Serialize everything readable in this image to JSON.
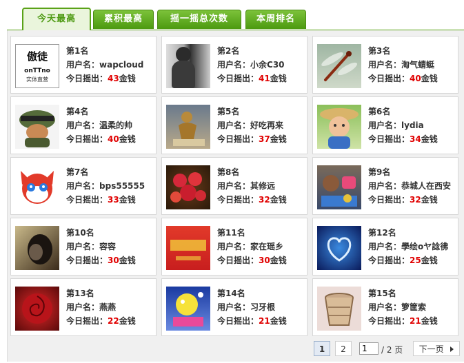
{
  "tabs": [
    {
      "label": "今天最高",
      "active": true
    },
    {
      "label": "累积最高",
      "active": false
    },
    {
      "label": "摇一摇总次数",
      "active": false
    },
    {
      "label": "本周排名",
      "active": false
    }
  ],
  "field_labels": {
    "user": "用户名：",
    "today": "今日摇出：",
    "unit": "金钱"
  },
  "logo_text": {
    "line1": "傲徒",
    "line2": "onTTno",
    "line3": "实体直营"
  },
  "rankings": [
    {
      "rank": "第1名",
      "user": "wapcloud",
      "count": "43",
      "thumb": "logo"
    },
    {
      "rank": "第2名",
      "user": "小余C30",
      "count": "41",
      "thumb": "figure-grey"
    },
    {
      "rank": "第3名",
      "user": "淘气蜻蜓",
      "count": "40",
      "thumb": "dragonfly"
    },
    {
      "rank": "第4名",
      "user": "温柔的帅",
      "count": "40",
      "thumb": "helmet-cartoon"
    },
    {
      "rank": "第5名",
      "user": "好吃再来",
      "count": "37",
      "thumb": "bronze-figure"
    },
    {
      "rank": "第6名",
      "user": "lydia",
      "count": "34",
      "thumb": "child-hat"
    },
    {
      "rank": "第7名",
      "user": "bps55555",
      "count": "33",
      "thumb": "red-fox-cartoon"
    },
    {
      "rank": "第8名",
      "user": "其修远",
      "count": "32",
      "thumb": "red-flower"
    },
    {
      "rank": "第9名",
      "user": "恭城人在西安",
      "count": "32",
      "thumb": "toys"
    },
    {
      "rank": "第10名",
      "user": "容容",
      "count": "30",
      "thumb": "dark-portrait"
    },
    {
      "rank": "第11名",
      "user": "家在瑶乡",
      "count": "30",
      "thumb": "red-banner"
    },
    {
      "rank": "第12名",
      "user": "學绘oヤ諗彿",
      "count": "25",
      "thumb": "blue-heart"
    },
    {
      "rank": "第13名",
      "user": "燕燕",
      "count": "22",
      "thumb": "red-rose"
    },
    {
      "rank": "第14名",
      "user": "习牙根",
      "count": "21",
      "thumb": "christmas-card"
    },
    {
      "rank": "第15名",
      "user": "箩筐索",
      "count": "21",
      "thumb": "basket"
    }
  ],
  "pager": {
    "pages": [
      "1",
      "2"
    ],
    "current": "1",
    "input_value": "1",
    "total": "/ 2 页",
    "next": "下一页"
  },
  "colors": {
    "tab_green": "#5aa218",
    "count_red": "#e00000",
    "card_border": "#d7d7d7"
  }
}
